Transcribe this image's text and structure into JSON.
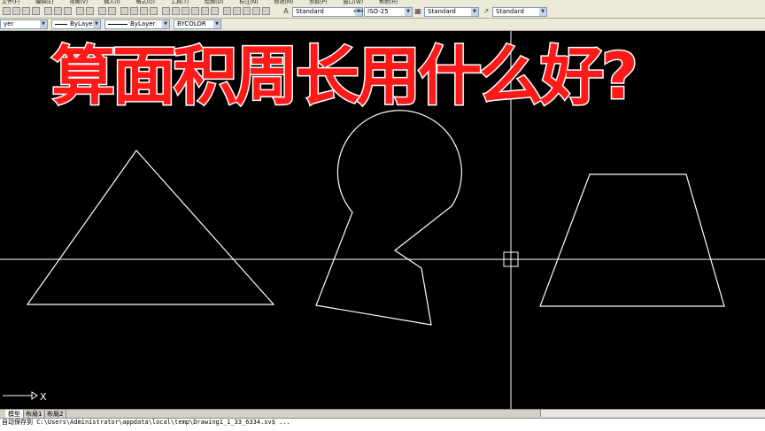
{
  "menu": {
    "items": [
      "文件(F)",
      "编辑(E)",
      "视图(V)",
      "插入(I)",
      "格式(O)",
      "工具(T)",
      "绘图(D)",
      "标注(N)",
      "修改(M)",
      "参数(P)",
      "窗口(W)",
      "帮助(H)"
    ]
  },
  "styles_toolbar": {
    "text_style": "Standard",
    "dim_style": "ISO-25",
    "table_style": "Standard",
    "multileader_style": "Standard"
  },
  "properties_toolbar": {
    "layer": "yer",
    "color": "ByLayer",
    "linetype": "ByLayer",
    "lineweight": "BYCOLOR"
  },
  "headline": "算面积周长用什么好?",
  "layout_tabs": {
    "model": "模型",
    "layout1": "布局1",
    "layout2": "布局2"
  },
  "command_line": "自动保存到 C:\\Users\\Administrator\\appdata\\local\\temp\\Drawing1_1_33_6334.sv$ ...",
  "ucs": {
    "x_label": "X"
  },
  "colors": {
    "background": "#000000",
    "geometry": "#ffffff",
    "headline_fill": "#ff1a1a",
    "headline_stroke": "#ffffff"
  }
}
